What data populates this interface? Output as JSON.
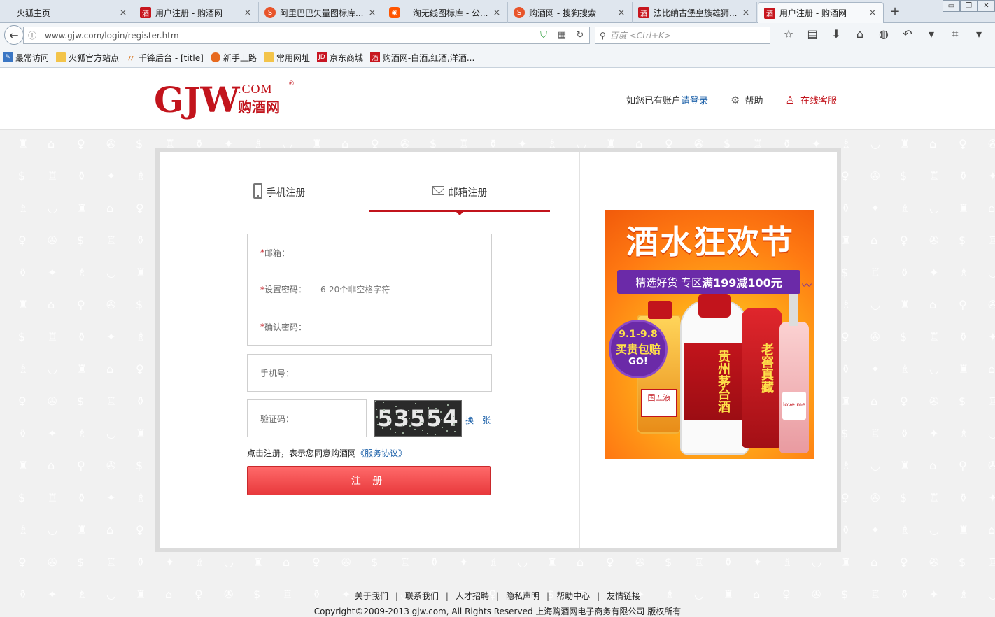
{
  "browser": {
    "tabs": [
      {
        "label": "火狐主页",
        "icon": "none"
      },
      {
        "label": "用户注册 - 购酒网",
        "icon": "jiu-icon"
      },
      {
        "label": "阿里巴巴矢量图标库...",
        "icon": "sogou-icon"
      },
      {
        "label": "一淘无线图标库 - 公...",
        "icon": "taobao-icon"
      },
      {
        "label": "购酒网 - 搜狗搜索",
        "icon": "sogou-icon"
      },
      {
        "label": "法比纳古堡皇族雄狮...",
        "icon": "jiu-icon"
      },
      {
        "label": "用户注册 - 购酒网",
        "icon": "jiu-icon"
      }
    ],
    "url": "www.gjw.com/login/register.htm",
    "search_placeholder": "百度 <Ctrl+K>",
    "bookmarks": [
      {
        "label": "最常访问",
        "icon": "blue"
      },
      {
        "label": "火狐官方站点",
        "icon": "folder"
      },
      {
        "label": "千锋后台 - [title]",
        "icon": "q"
      },
      {
        "label": "新手上路",
        "icon": "fx"
      },
      {
        "label": "常用网址",
        "icon": "folder"
      },
      {
        "label": "京东商城",
        "icon": "jd"
      },
      {
        "label": "购酒网-白酒,红酒,洋酒...",
        "icon": "jiu"
      }
    ]
  },
  "header": {
    "logo_main": "GJW",
    "logo_com": ".COM",
    "logo_cn": "购酒网",
    "logo_reg": "®",
    "has_account": "如您已有账户",
    "login_link": "请登录",
    "help": "帮助",
    "customer_service": "在线客服"
  },
  "register": {
    "tab_phone": "手机注册",
    "tab_email": "邮箱注册",
    "active_tab": "email",
    "required_mark": "*",
    "email_label": "邮箱：",
    "password_label": "设置密码：",
    "password_placeholder": "6-20个非空格字符",
    "confirm_label": "确认密码：",
    "mobile_label": "手机号：",
    "captcha_label": "验证码：",
    "captcha_code": "53554",
    "refresh_captcha": "换一张",
    "agree_text": "点击注册，表示您同意购酒网",
    "service_link": "《服务协议》",
    "submit": "注 册"
  },
  "promo": {
    "title": "酒水狂欢节",
    "ribbon_prefix": "精选好货 专区",
    "ribbon_offer": "满199减100元",
    "badge_date": "9.1-9.8",
    "badge_text": "买贵包赔",
    "badge_go": "GO!",
    "label_wuliang": "国五液",
    "label_maotai": "贵州茅台酒",
    "label_laojiao": "老窖真藏",
    "label_rose": "love me"
  },
  "footer": {
    "links": [
      "关于我们",
      "联系我们",
      "人才招聘",
      "隐私声明",
      "帮助中心",
      "友情链接"
    ],
    "separator": "|",
    "copyright": "Copyright©2009-2013 gjw.com, All Rights Reserved 上海购酒网电子商务有限公司 版权所有"
  },
  "colors": {
    "brand_red": "#c2141c",
    "link_blue": "#1a5fa8",
    "purple": "#6b2aa8"
  }
}
